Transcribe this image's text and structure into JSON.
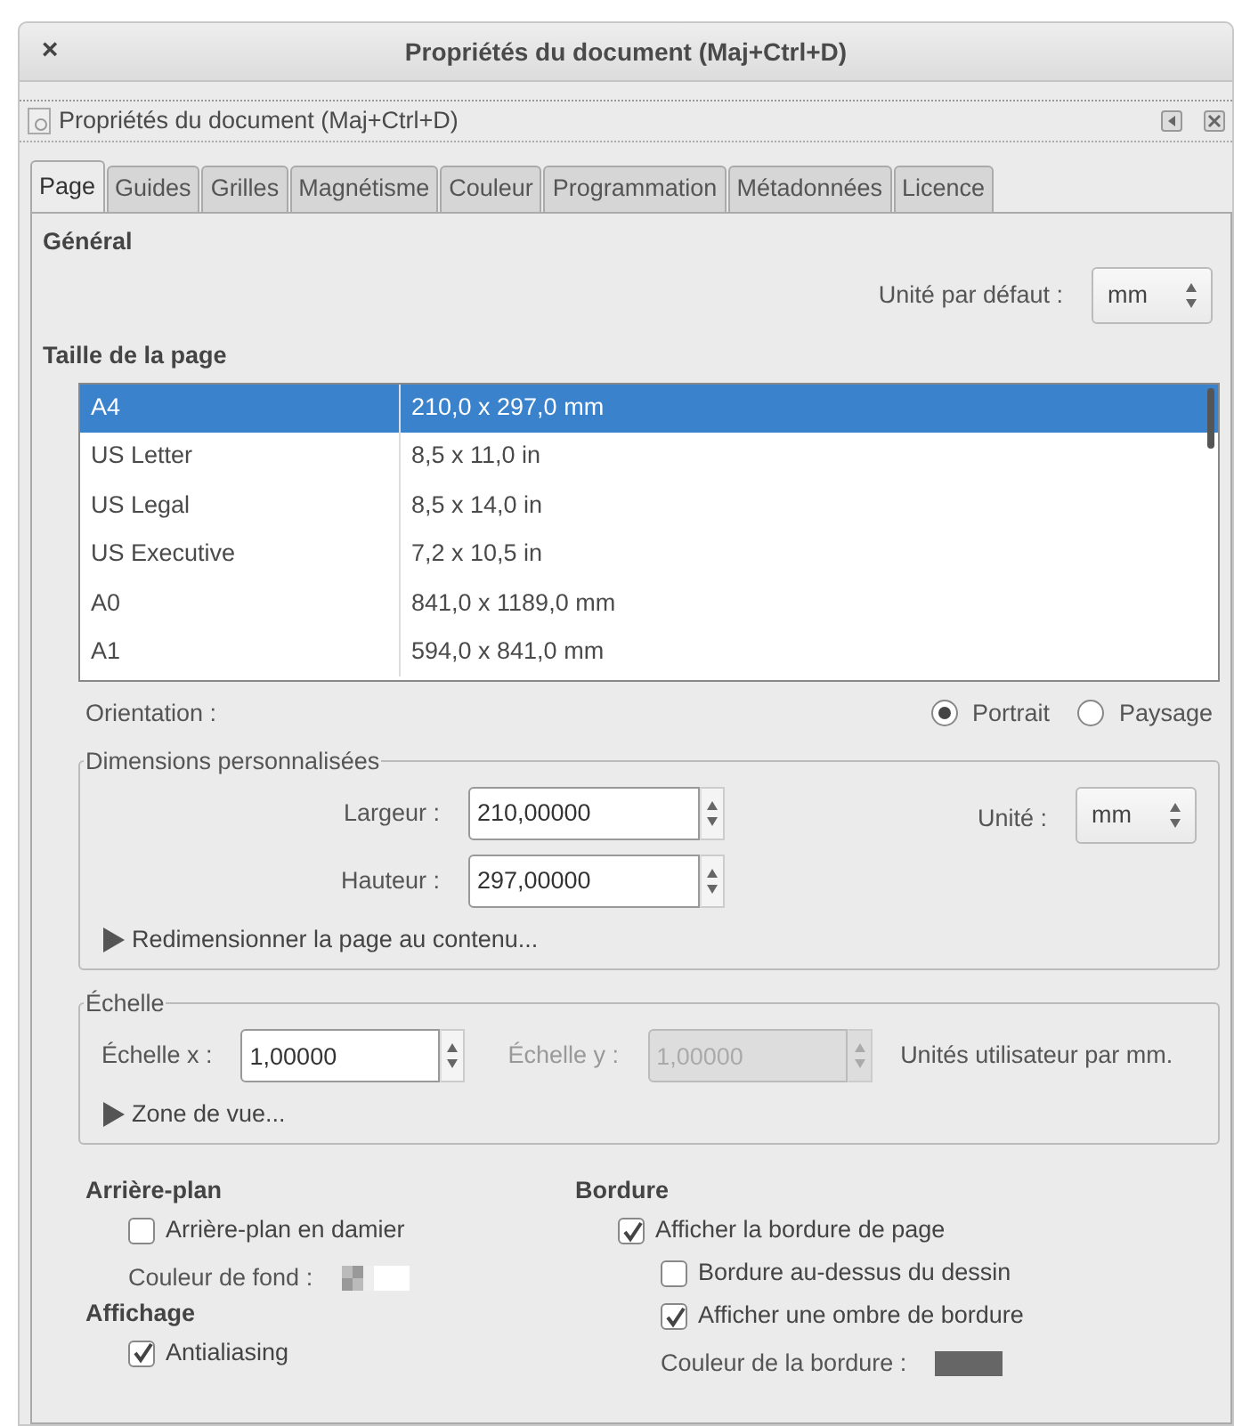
{
  "window": {
    "title": "Propriétés du document (Maj+Ctrl+D)",
    "close": "×"
  },
  "dock": {
    "title": "Propriétés du document (Maj+Ctrl+D)"
  },
  "tabs": [
    {
      "label": "Page",
      "selected": true
    },
    {
      "label": "Guides",
      "selected": false
    },
    {
      "label": "Grilles",
      "selected": false
    },
    {
      "label": "Magnétisme",
      "selected": false
    },
    {
      "label": "Couleur",
      "selected": false
    },
    {
      "label": "Programmation",
      "selected": false
    },
    {
      "label": "Métadonnées",
      "selected": false
    },
    {
      "label": "Licence",
      "selected": false
    }
  ],
  "general": {
    "heading": "Général",
    "default_unit": {
      "label": "Unité par défaut :",
      "value": "mm"
    }
  },
  "page_size": {
    "heading": "Taille de la page",
    "rows": [
      {
        "name": "A4",
        "size": "210,0 x 297,0 mm",
        "selected": true
      },
      {
        "name": "US Letter",
        "size": "8,5 x 11,0 in",
        "selected": false
      },
      {
        "name": "US Legal",
        "size": "8,5 x 14,0 in",
        "selected": false
      },
      {
        "name": "US Executive",
        "size": "7,2 x 10,5 in",
        "selected": false
      },
      {
        "name": "A0",
        "size": "841,0 x 1189,0 mm",
        "selected": false
      },
      {
        "name": "A1",
        "size": "594,0 x 841,0 mm",
        "selected": false
      }
    ]
  },
  "orientation": {
    "label": "Orientation :",
    "options": [
      {
        "label": "Portrait",
        "selected": true
      },
      {
        "label": "Paysage",
        "selected": false
      }
    ]
  },
  "custom_size": {
    "legend": "Dimensions personnalisées",
    "width": {
      "label": "Largeur :",
      "value": "210,00000"
    },
    "height": {
      "label": "Hauteur :",
      "value": "297,00000"
    },
    "unit": {
      "label": "Unité :",
      "value": "mm"
    },
    "expander": {
      "label": "Redimensionner la page au contenu...",
      "expanded": false
    }
  },
  "scale": {
    "legend": "Échelle",
    "x": {
      "label": "Échelle x :",
      "value": "1,00000",
      "disabled": false
    },
    "y": {
      "label": "Échelle y :",
      "value": "1,00000",
      "disabled": true
    },
    "note": "Unités utilisateur par mm.",
    "expander": {
      "label": "Zone de vue...",
      "expanded": false
    }
  },
  "background": {
    "heading": "Arrière-plan",
    "checkerboard": {
      "label": "Arrière-plan en damier",
      "checked": false
    },
    "color_label": "Couleur de fond :"
  },
  "display": {
    "heading": "Affichage",
    "antialiasing": {
      "label": "Antialiasing",
      "checked": true
    }
  },
  "border": {
    "heading": "Bordure",
    "options": [
      {
        "label": "Afficher la bordure de page",
        "checked": true,
        "children": [
          {
            "label": "Bordure au-dessus du dessin",
            "checked": false
          },
          {
            "label": "Afficher une ombre de bordure",
            "checked": true
          }
        ]
      }
    ],
    "color_label": "Couleur de la bordure :"
  }
}
